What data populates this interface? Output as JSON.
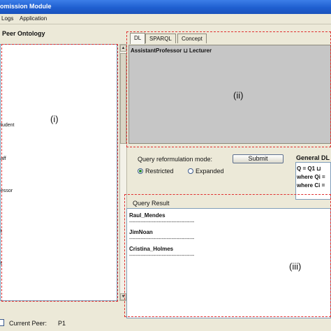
{
  "window": {
    "title": "omission Module"
  },
  "menu": [
    "Logs",
    "Application"
  ],
  "peer_panel": {
    "title": "Peer Ontology",
    "tree_items": [
      "tudent",
      "aff",
      "essor",
      "t",
      "t"
    ],
    "region_label": "(i)"
  },
  "tabs": [
    {
      "label": "DL",
      "active": true
    },
    {
      "label": "SPARQL",
      "active": false
    },
    {
      "label": "Concept",
      "active": false
    }
  ],
  "dl_panel": {
    "expression": "AssistantProfessor ⊔ Lecturer",
    "region_label": "(ii)"
  },
  "reformulation": {
    "mode_label": "Query reformulation mode:",
    "submit_label": "Submit",
    "options": [
      {
        "label": "Restricted",
        "selected": true
      },
      {
        "label": "Expanded",
        "selected": false
      }
    ]
  },
  "general_dl": {
    "title": "General DL",
    "lines": [
      "Q = Q1 ⊔",
      "where Qi =",
      "where Ci ="
    ]
  },
  "query_result": {
    "title": "Query Result",
    "results": [
      "Raul_Mendes",
      "JimNoan",
      "Cristina_Holmes"
    ],
    "separator": "----------------------------------------",
    "region_label": "(iii)"
  },
  "status": {
    "label": "Current Peer:",
    "value": "P1"
  },
  "colors": {
    "titlebar": "#1f5fd0",
    "annotation_dash": "#e03030",
    "dl_background": "#c6c6c6",
    "window_background": "#ece9d8"
  }
}
